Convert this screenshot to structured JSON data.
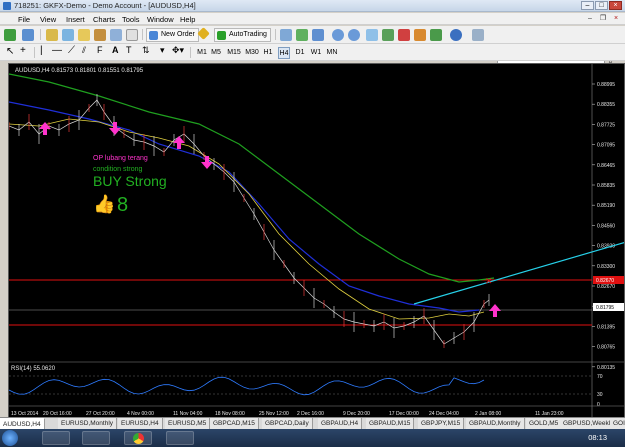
{
  "window": {
    "title": "718251: GKFX-Demo - Demo Account - [AUDUSD,H4]"
  },
  "menu": [
    "File",
    "View",
    "Insert",
    "Charts",
    "Tools",
    "Window",
    "Help"
  ],
  "toolbar": {
    "new_order": "New Order",
    "autotrading": "AutoTrading"
  },
  "timeframes": [
    "M1",
    "M5",
    "M15",
    "M30",
    "H1",
    "H4",
    "D1",
    "W1",
    "MN"
  ],
  "active_timeframe": "H4",
  "chart": {
    "symbol_header": "AUDUSD,H4  0.81573 0.81801 0.81551 0.81795",
    "price_labels": [
      "0.88995",
      "0.88355",
      "0.87725",
      "0.87095",
      "0.86465",
      "0.85835",
      "0.85190",
      "0.84560",
      "0.83930",
      "0.83300",
      "0.82670",
      "0.82040",
      "0.81395",
      "0.80765",
      "0.80135"
    ],
    "price_highlight_red": "0.82670",
    "price_highlight_current": "0.81795",
    "annotation_op": "OP lubang terang",
    "annotation_condition": "condition strong",
    "annotation_signal": "BUY Strong",
    "annotation_digit": "8",
    "rsi_header": "RSI(14) 55.0620",
    "rsi_levels": [
      "70",
      "30",
      "0"
    ],
    "time_labels": [
      "13 Oct 2014",
      "20 Oct 16:00",
      "27 Oct 20:00",
      "4 Nov 00:00",
      "11 Nov 04:00",
      "18 Nov 08:00",
      "25 Nov 12:00",
      "2 Dec 16:00",
      "9 Dec 20:00",
      "17 Dec 00:00",
      "24 Dec 04:00",
      "2 Jan 08:00",
      "11 Jan 23:00"
    ],
    "colors": {
      "background": "#000000",
      "ma_green": "#1f9f1f",
      "ma_blue": "#1f2fd8",
      "ma_yellow": "#e0d040",
      "price_line": "#d8d8d8",
      "red_line": "#e01010",
      "trend_line": "#26d0e8",
      "arrow_magenta": "#ff33cc"
    }
  },
  "tabs": [
    "AUDUSD,H4",
    "EURUSD,Monthly",
    "EURUSD,H4",
    "EURUSD,M5",
    "GBPCAD,M15",
    "GBPCAD,Daily",
    "GBPAUD,H4",
    "GBPAUD,M15",
    "GBPJPY,M15",
    "GBPAUD,Monthly",
    "GOLD,M5",
    "GBPUSD,Weekly",
    "GOI"
  ],
  "taskbar": {
    "clock": "08:13"
  }
}
